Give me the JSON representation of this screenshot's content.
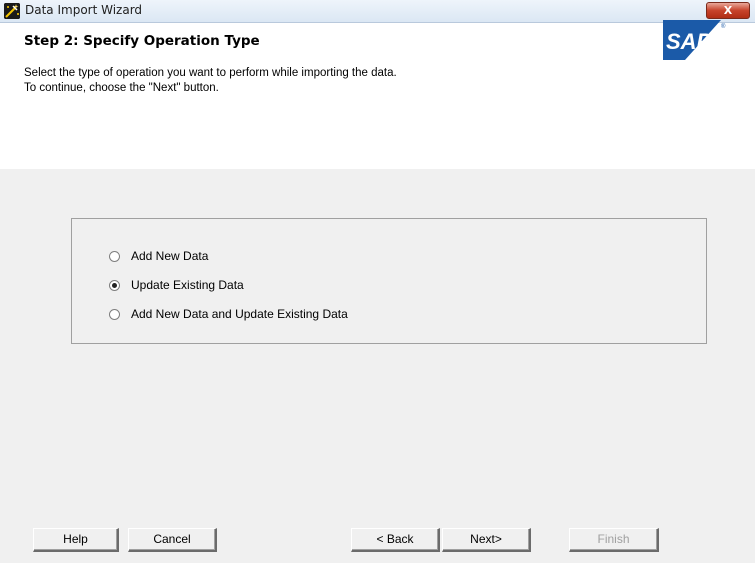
{
  "window": {
    "title": "Data Import Wizard",
    "close_glyph": "X"
  },
  "header": {
    "step_title": "Step 2: Specify Operation Type",
    "description_line1": "Select the type of operation you want to perform while importing the data.",
    "description_line2": "To continue, choose the \"Next\" button.",
    "logo_text": "SAP"
  },
  "options": [
    {
      "label": "Add New Data",
      "selected": false
    },
    {
      "label": "Update Existing Data",
      "selected": true
    },
    {
      "label": "Add New Data and Update Existing Data",
      "selected": false
    }
  ],
  "buttons": {
    "help": "Help",
    "cancel": "Cancel",
    "back": "< Back",
    "next": "Next>",
    "finish": "Finish",
    "finish_enabled": false
  },
  "colors": {
    "sap_blue": "#1b5aa8",
    "close_red": "#c7432b"
  }
}
